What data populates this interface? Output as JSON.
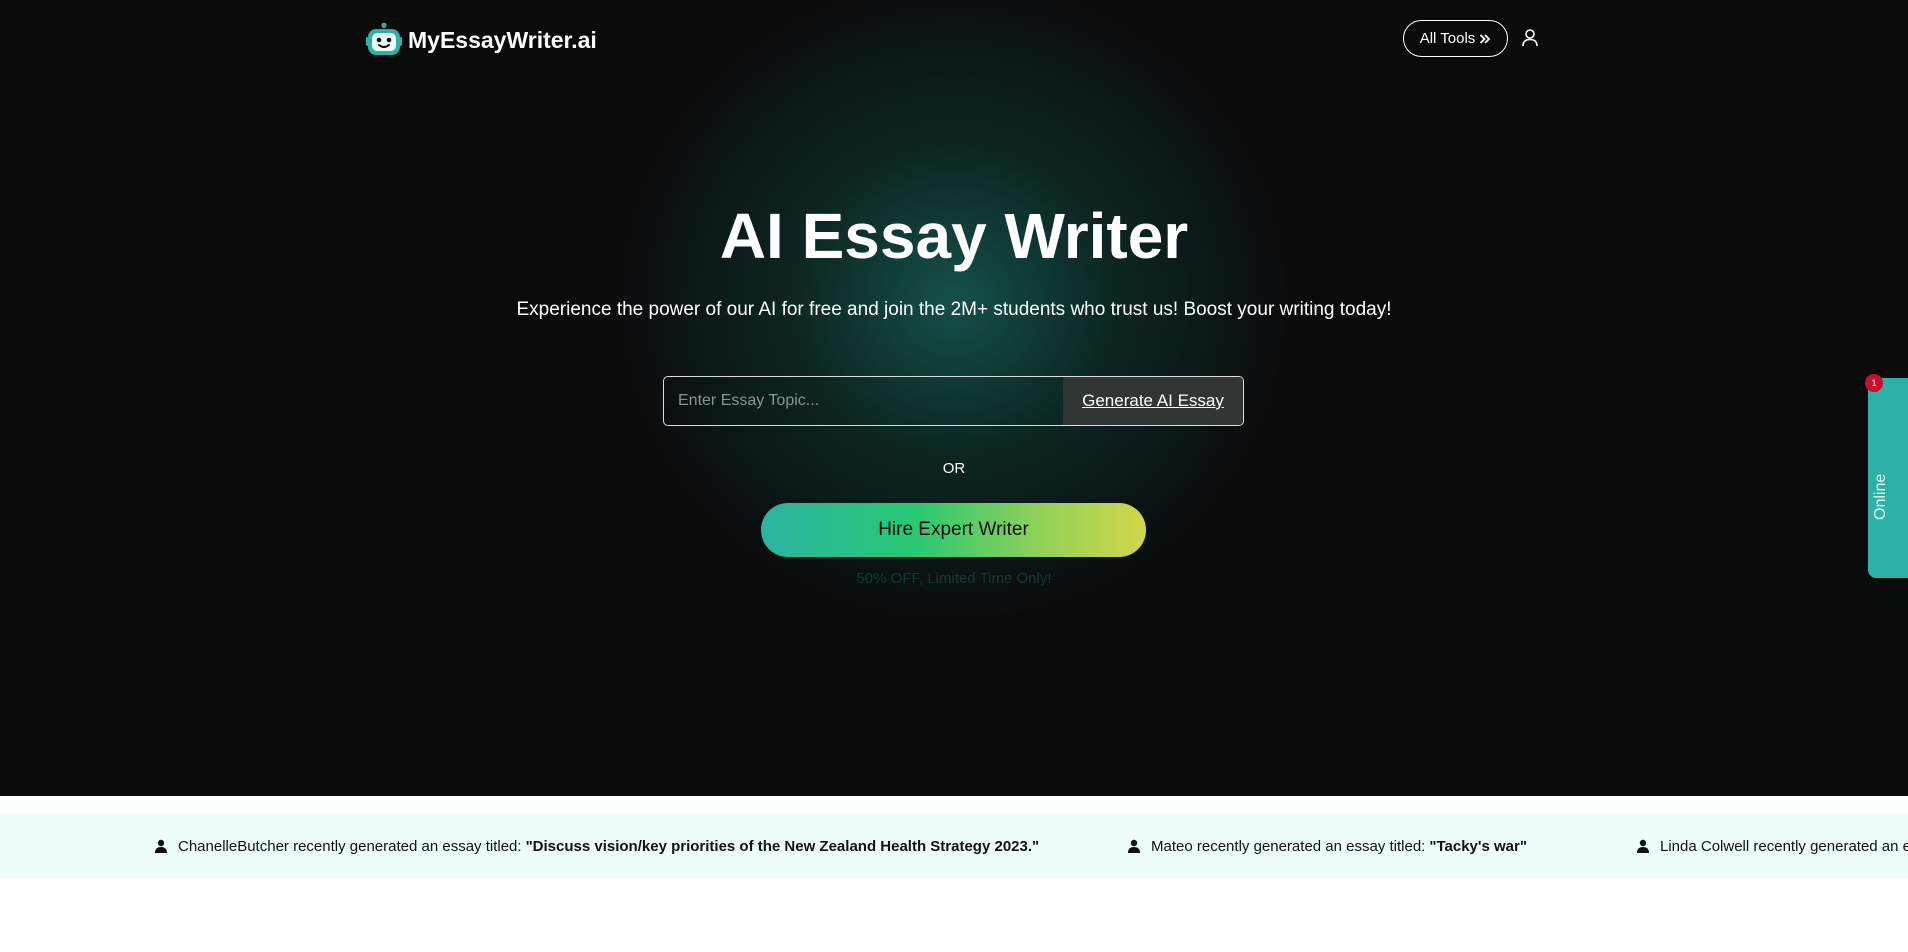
{
  "header": {
    "logo_text": "MyEssayWriter.ai",
    "all_tools_label": "All Tools",
    "icons": [
      "robot-logo-icon",
      "double-chevron-right-icon",
      "user-icon"
    ]
  },
  "hero": {
    "title": "AI Essay Writer",
    "subtitle": "Experience the power of our AI for free and join the 2M+ students who trust us! Boost your writing today!",
    "search": {
      "placeholder": "Enter Essay Topic...",
      "value": "",
      "button_label": "Generate AI Essay"
    },
    "or_label": "OR",
    "hire_button_label": "Hire Expert Writer",
    "offer_text": "50% OFF, Limited Time Only!"
  },
  "side_widget": {
    "label": "Online",
    "badge_count": "1"
  },
  "ticker": {
    "items": [
      {
        "user": "ChanelleButcher",
        "action": "recently generated an essay titled:",
        "title": "\"Discuss vision/key priorities of the New Zealand Health Strategy 2023.\""
      },
      {
        "user": "Mateo",
        "action": "recently generated an essay titled:",
        "title": "\"Tacky's war\""
      },
      {
        "user": "Linda Colwell",
        "action": "recently generated an e",
        "title": ""
      }
    ]
  },
  "colors": {
    "hero_bg": "#0a0b0b",
    "glow": "#186e62",
    "accent_teal": "#2bb1a5",
    "gradient_start": "#2bb3a3",
    "gradient_end": "#d4d64a",
    "ticker_bg": "#ecfdfb",
    "badge_red": "#c8102e"
  }
}
